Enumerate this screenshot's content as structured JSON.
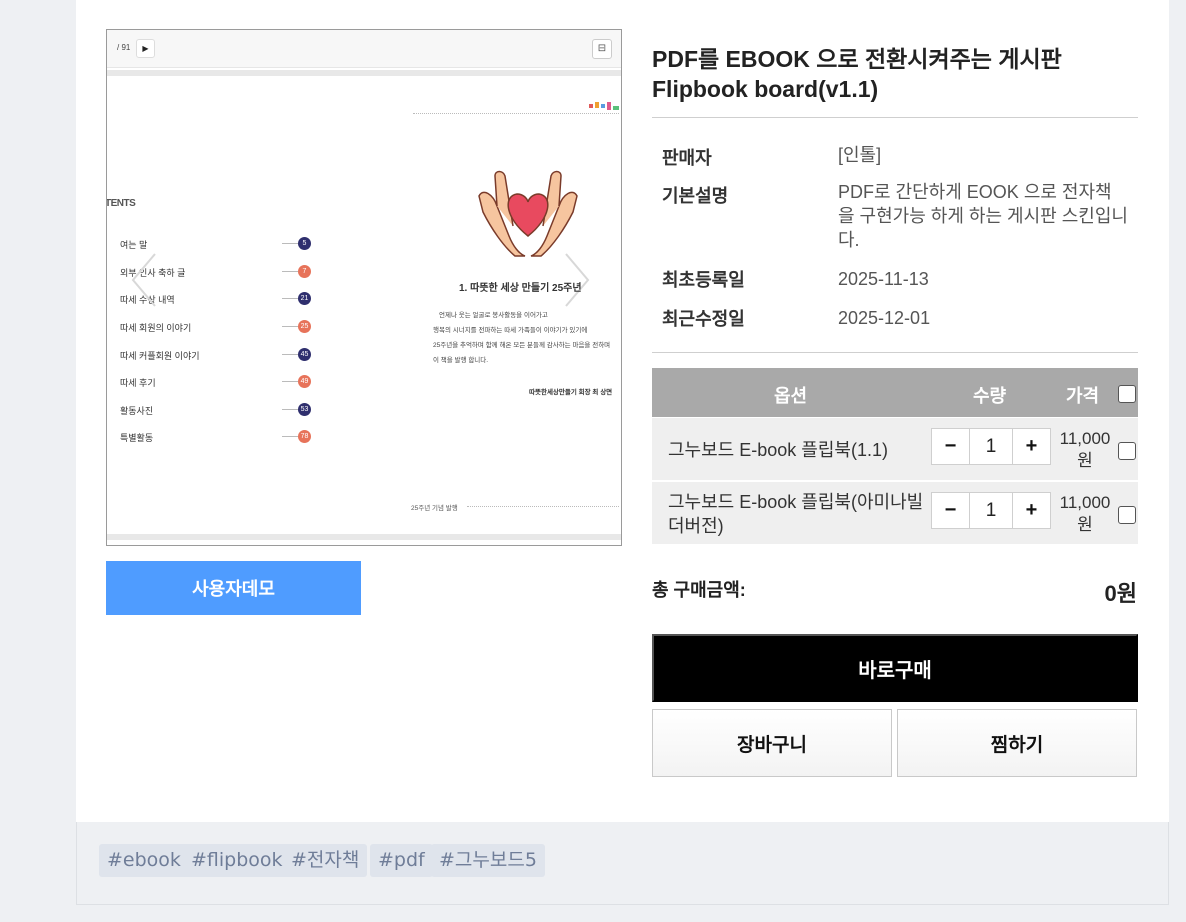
{
  "preview": {
    "page_count": "/ 91",
    "play_icon": "▶",
    "menu_icon": "⊟",
    "contents_label": "TENTS",
    "items": [
      {
        "label": "여는 말",
        "num": "5",
        "color": "#2f2f6e"
      },
      {
        "label": "외부 인사 축하 글",
        "num": "7",
        "color": "#e7735a"
      },
      {
        "label": "따세 수상 내역",
        "num": "21",
        "color": "#2f2f6e"
      },
      {
        "label": "따세 회원의 이야기",
        "num": "25",
        "color": "#e7735a"
      },
      {
        "label": "따세 커플회원 이야기",
        "num": "45",
        "color": "#2f2f6e"
      },
      {
        "label": "따세 후기",
        "num": "49",
        "color": "#e7735a"
      },
      {
        "label": "활동사진",
        "num": "53",
        "color": "#2f2f6e"
      },
      {
        "label": "특별활동",
        "num": "78",
        "color": "#e7735a"
      }
    ],
    "section_title": "1. 따뜻한 세상 만들기 25주년",
    "body_lines": [
      "언제나 웃는 얼굴로 봉사활동을 이어가고",
      "행복의 시너지를 전파하는 따세 가족들이 이야기가 있기에",
      "25주년을 추억하며 함께 해온 모든 분들께 감사하는 마음을 전하며",
      "이 책을 발행 합니다."
    ],
    "signature": "따뜻한세상만들기 회장 최 상면",
    "footer": "25주년 기념 발행"
  },
  "demo_button": "사용자데모",
  "product": {
    "title_line1": "PDF를 EBOOK 으로 전환시켜주는 게시판",
    "title_line2": "Flipbook board(v1.1)",
    "info": [
      {
        "label": "판매자",
        "value": "[인톨]"
      },
      {
        "label": "기본설명",
        "value": "PDF로 간단하게 EOOK 으로 전자책을 구현가능 하게 하는 게시판 스킨입니다."
      },
      {
        "label": "최초등록일",
        "value": "2025-11-13"
      },
      {
        "label": "최근수정일",
        "value": "2025-12-01"
      }
    ]
  },
  "options": {
    "headers": {
      "option": "옵션",
      "qty": "수량",
      "price": "가격"
    },
    "rows": [
      {
        "name": "그누보드 E-book 플립북(1.1)",
        "qty": "1",
        "price": "11,000원"
      },
      {
        "name": "그누보드 E-book 플립북(아미나빌더버전)",
        "qty": "1",
        "price": "11,000원"
      }
    ],
    "minus": "−",
    "plus": "+"
  },
  "total": {
    "label": "총 구매금액:",
    "value": "0원"
  },
  "buttons": {
    "buy": "바로구매",
    "cart": "장바구니",
    "wish": "찜하기"
  },
  "tags": [
    "#ebook",
    "#flipbook",
    "#전자책",
    "#pdf",
    "#그누보드5"
  ]
}
